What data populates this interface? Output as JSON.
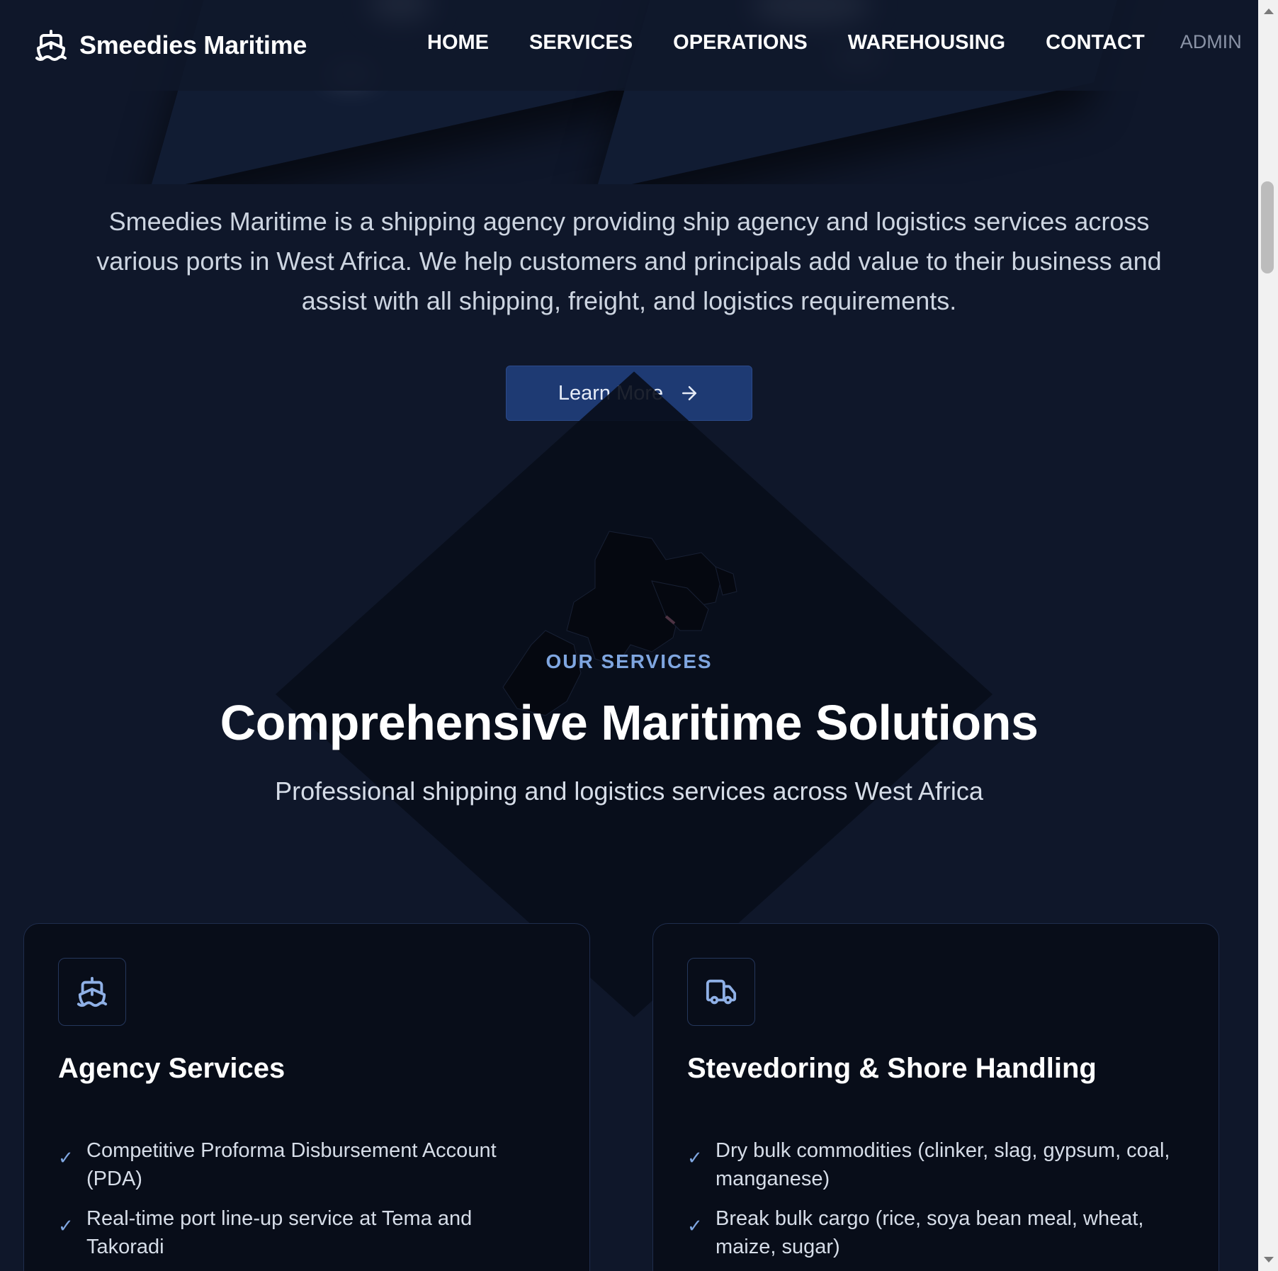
{
  "brand": {
    "name": "Smeedies Maritime",
    "icon": "ship-icon"
  },
  "nav": {
    "links": [
      "HOME",
      "SERVICES",
      "OPERATIONS",
      "WAREHOUSING",
      "CONTACT"
    ],
    "admin": "ADMIN"
  },
  "intro": {
    "text": "Smeedies Maritime is a shipping agency providing ship agency and logistics services across various ports in West Africa. We help customers and principals add value to their business and assist with all shipping, freight, and logistics requirements.",
    "button_label": "Learn More",
    "button_icon": "arrow-right-icon"
  },
  "services": {
    "eyebrow": "OUR SERVICES",
    "title": "Comprehensive Maritime Solutions",
    "subtitle": "Professional shipping and logistics services across West Africa",
    "cards": [
      {
        "icon": "ship-icon",
        "title": "Agency Services",
        "items": [
          "Competitive Proforma Disbursement Account (PDA)",
          "Real-time port line-up service at Tema and Takoradi"
        ]
      },
      {
        "icon": "truck-icon",
        "title": "Stevedoring & Shore Handling",
        "items": [
          "Dry bulk commodities (clinker, slag, gypsum, coal, manganese)",
          "Break bulk cargo (rice, soya bean meal, wheat, maize, sugar)"
        ]
      }
    ]
  },
  "colors": {
    "background": "#0f172a",
    "accent": "#7fa6e0",
    "button": "#1e3a73",
    "card": "#080d19"
  },
  "check_glyph": "✓"
}
